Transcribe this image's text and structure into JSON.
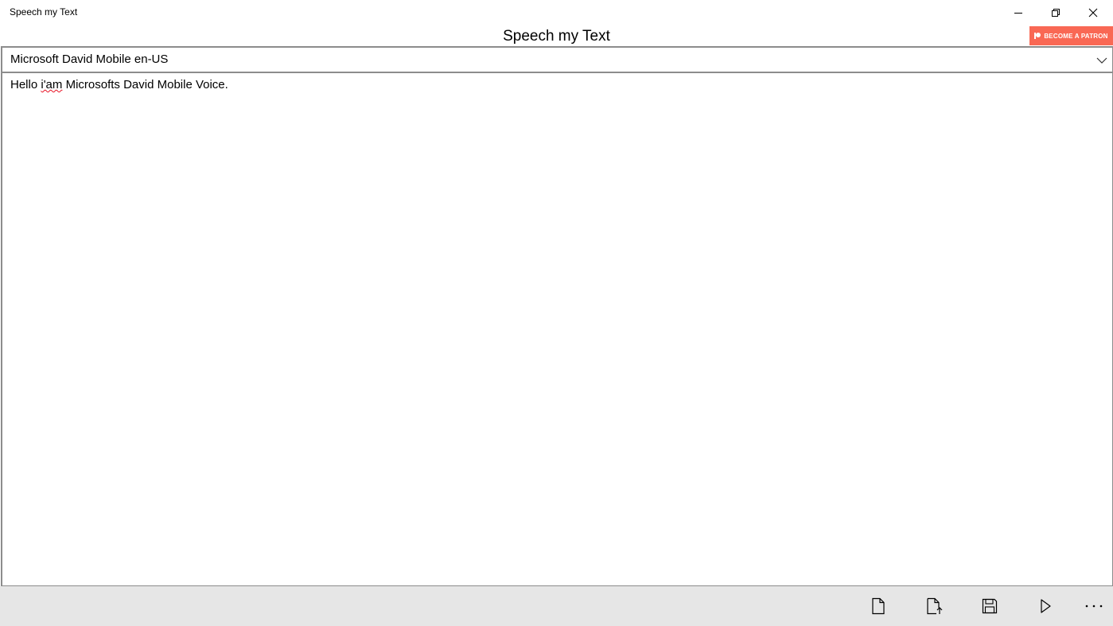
{
  "window": {
    "title": "Speech my Text",
    "minimize_icon": "minimize-icon",
    "restore_icon": "restore-icon",
    "close_icon": "close-icon"
  },
  "header": {
    "app_title": "Speech my Text",
    "patron_button": {
      "label": "BECOME A PATRON",
      "icon": "patreon-icon",
      "color": "#f96854"
    }
  },
  "voice_select": {
    "selected": "Microsoft David Mobile en-US",
    "icon": "chevron-down-icon"
  },
  "editor": {
    "text_before": "Hello ",
    "misspelled_word": "i'am",
    "text_after": " Microsofts David Mobile Voice."
  },
  "command_bar": {
    "buttons": [
      {
        "name": "new",
        "icon": "new-document-icon"
      },
      {
        "name": "open",
        "icon": "open-file-icon"
      },
      {
        "name": "save",
        "icon": "save-icon"
      },
      {
        "name": "play",
        "icon": "play-icon"
      },
      {
        "name": "more",
        "icon": "more-icon"
      }
    ],
    "background": "#e6e6e6"
  }
}
